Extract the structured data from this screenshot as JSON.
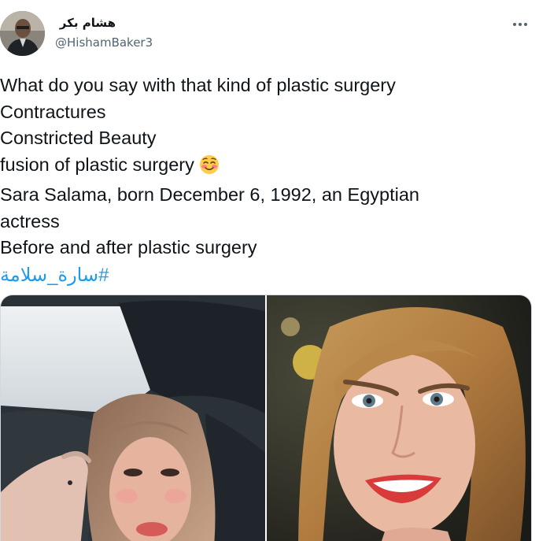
{
  "author": {
    "display_name": "هشام بكر",
    "handle": "@HishamBaker3",
    "avatar_icon": "user-avatar-photo"
  },
  "menu": {
    "more_icon": "more-horizontal-icon"
  },
  "tweet": {
    "lines": [
      "What do you say with that kind of plastic surgery",
      "Contractures",
      "Constricted Beauty",
      "fusion of plastic surgery",
      "Sara Salama, born December 6, 1992, an Egyptian",
      "actress",
      "Before and after plastic surgery"
    ],
    "emoji_icon": "smiling-face-with-blush-icon",
    "hashtag": "#سارة_سلامة"
  },
  "media": {
    "photos": [
      {
        "icon": "selfie-photo-before"
      },
      {
        "icon": "portrait-photo-after"
      }
    ]
  },
  "colors": {
    "text": "#0f1419",
    "secondary": "#536471",
    "link": "#1d9bf0",
    "border": "#cfd9de"
  }
}
